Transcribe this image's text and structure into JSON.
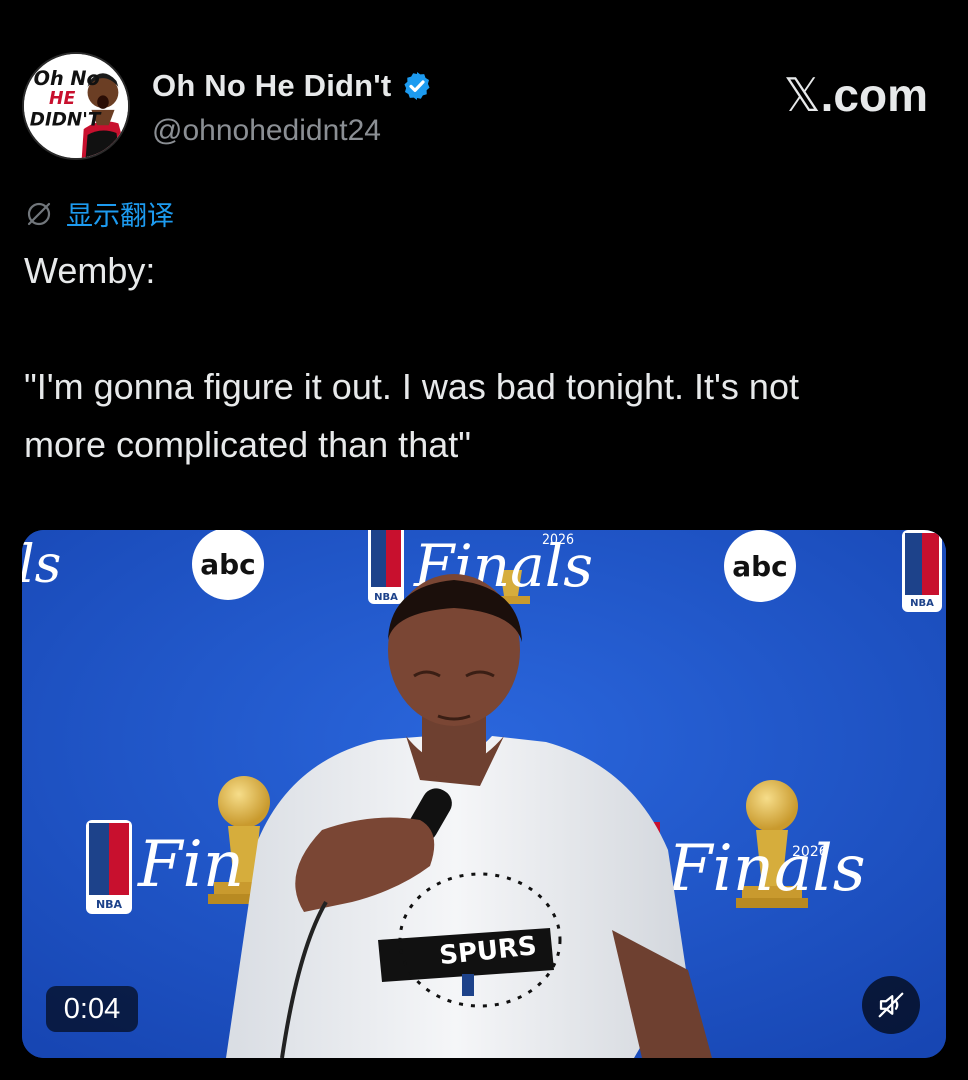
{
  "tweet": {
    "author": {
      "display_name": "Oh No He Didn't",
      "handle": "@ohnohedidnt24",
      "verified": true,
      "avatar_text_line1": "Oh No",
      "avatar_text_line2": "HE",
      "avatar_text_line3": "DIDN'T"
    },
    "brand": {
      "x_glyph": "𝕏",
      "suffix": ".com"
    },
    "translate_label": "显示翻译",
    "text_lines": [
      "Wemby:",
      "\"I'm gonna figure it out. I was bad tonight. It's not",
      "more complicated than that\""
    ],
    "media": {
      "timestamp": "0:04",
      "backdrop": {
        "finals_word": "Finals",
        "year": "2026",
        "network": "abc",
        "league": "NBA",
        "partial_left": "ls",
        "partial_center": "Fin"
      },
      "shirt_text": "SPURS",
      "mute_icon": "speaker-muted-icon"
    }
  },
  "colors": {
    "background": "#000000",
    "text": "#e7e9ea",
    "secondary_text": "#8b8f94",
    "link": "#1d9bf0",
    "verified": "#1d9bf0",
    "backdrop_blue": "#1d54c8"
  }
}
